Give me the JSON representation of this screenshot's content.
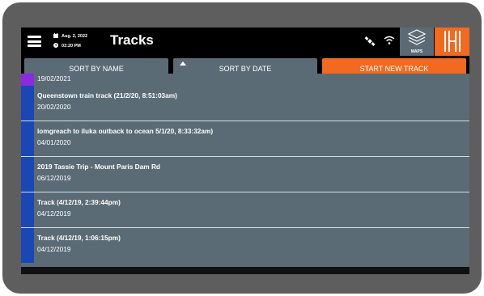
{
  "status": {
    "date": "Aug. 2, 2022",
    "time": "03:20 PM"
  },
  "header": {
    "title": "Tracks",
    "maps_label": "MAPS"
  },
  "sort": {
    "by_name": "SORT BY NAME",
    "by_date": "SORT BY DATE",
    "start": "START NEW TRACK"
  },
  "tracks": [
    {
      "name": "",
      "date": "19/02/2021"
    },
    {
      "name": "Queenstown train track (21/2/20, 8:51:03am)",
      "date": "20/02/2020"
    },
    {
      "name": " lomgreach to iluka outback to ocean 5/1/20, 8:33:32am)",
      "date": " 04/01/2020"
    },
    {
      "name": "2019 Tassie Trip - Mount Paris Dam Rd",
      "date": "06/12/2019"
    },
    {
      "name": "Track (4/12/19, 2:39:44pm)",
      "date": "04/12/2019"
    },
    {
      "name": "Track (4/12/19, 1:06:15pm)",
      "date": "04/12/2019"
    }
  ],
  "colors": {
    "accent": "#f26a21",
    "button": "#5b6b76",
    "stripe": "#1a47b3",
    "list_bg": "#5a6b76"
  }
}
